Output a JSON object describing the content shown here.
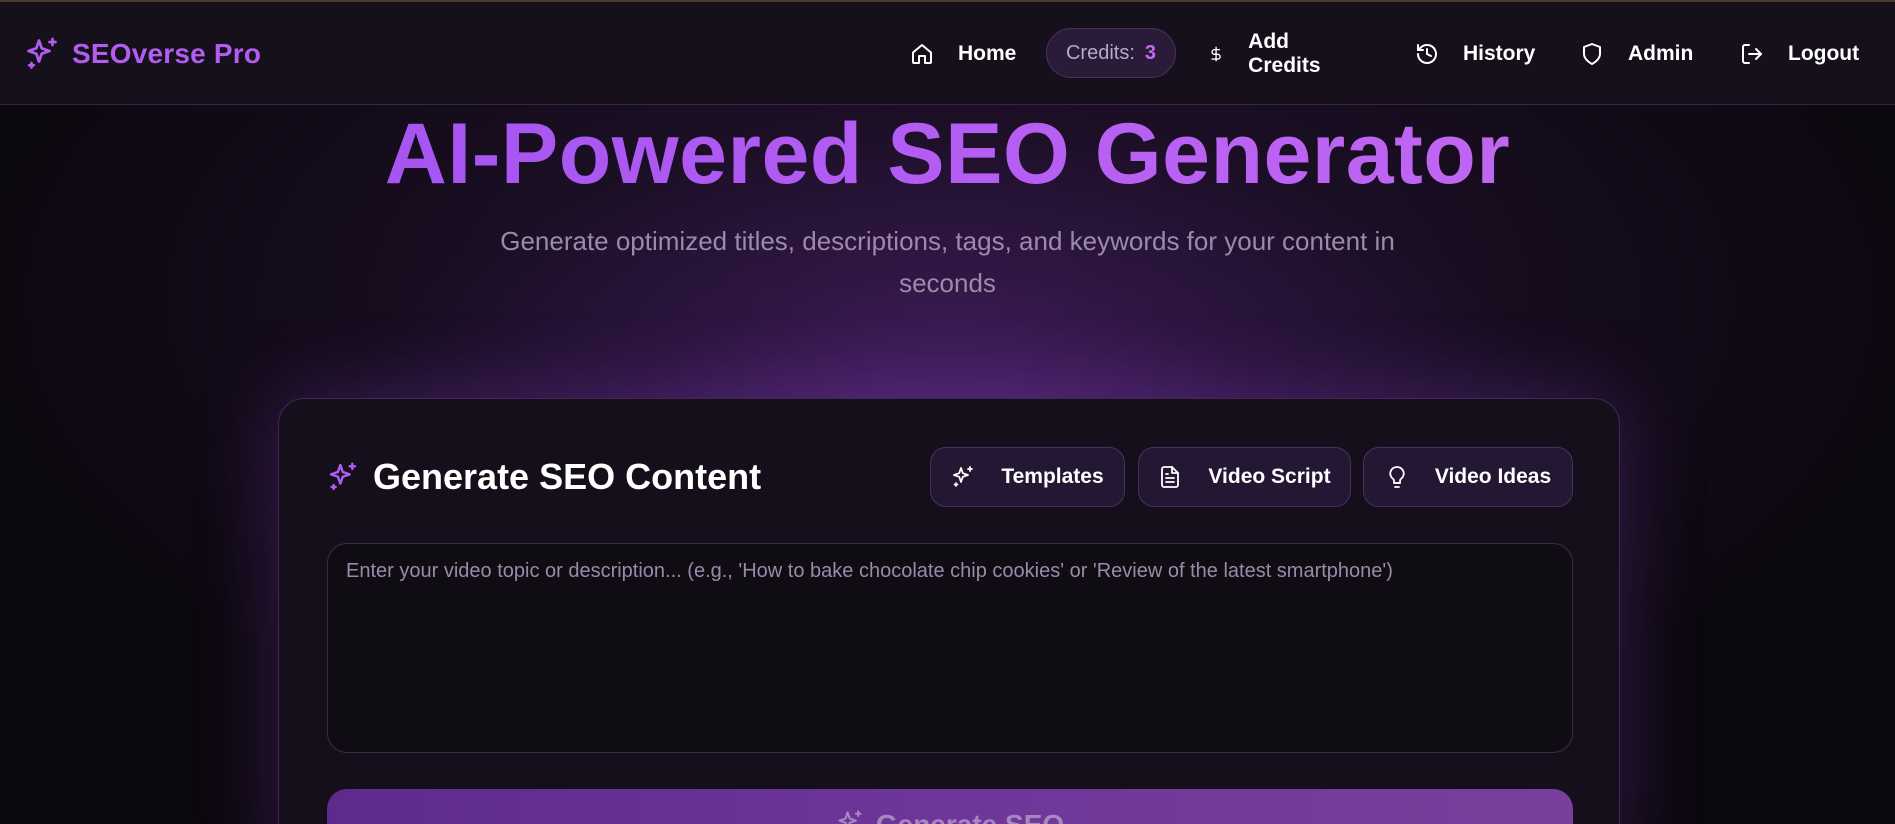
{
  "brand": {
    "name": "SEOverse Pro",
    "icon": "sparkles-icon"
  },
  "nav": {
    "home": {
      "label": "Home",
      "icon": "home-icon"
    },
    "credits": {
      "label": "Credits:",
      "count": "3"
    },
    "add_credits": {
      "label": "Add Credits",
      "icon": "dollar-icon"
    },
    "history": {
      "label": "History",
      "icon": "history-icon"
    },
    "admin": {
      "label": "Admin",
      "icon": "shield-icon"
    },
    "logout": {
      "label": "Logout",
      "icon": "logout-icon"
    }
  },
  "hero": {
    "title": "AI-Powered SEO Generator",
    "subtitle": "Generate optimized titles, descriptions, tags, and keywords for your content in seconds"
  },
  "card": {
    "title": "Generate SEO Content",
    "buttons": {
      "templates": "Templates",
      "video_script": "Video Script",
      "video_ideas": "Video Ideas"
    },
    "topic": {
      "value": "",
      "placeholder": "Enter your video topic or description... (e.g., 'How to bake chocolate chip cookies' or 'Review of the latest smartphone')"
    },
    "generate_label": "Generate SEO"
  },
  "colors": {
    "accent": "#b25cf0",
    "background": "#0c080f",
    "navbar": "#15101c",
    "card": "#150f1b"
  }
}
